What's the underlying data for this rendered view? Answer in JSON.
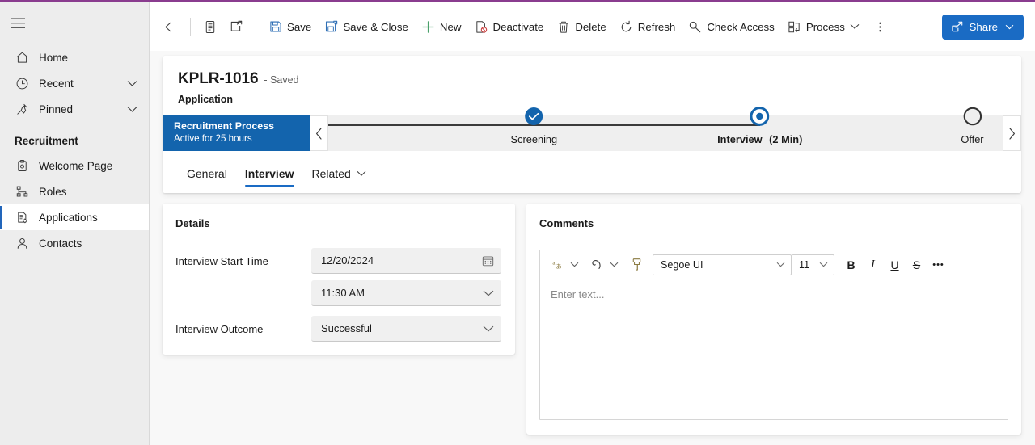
{
  "theme": {
    "accent_bar_color": "#8a3c8f",
    "primary_blue": "#1a6bc4",
    "bpf_header_blue": "#1364ad",
    "selection_bar_blue": "#2266bb"
  },
  "sidebar": {
    "hamburger_icon": "hamburger-menu-icon",
    "items": [
      {
        "label": "Home",
        "icon": "home-icon",
        "expandable": false,
        "selected": false
      },
      {
        "label": "Recent",
        "icon": "clock-icon",
        "expandable": true,
        "selected": false
      },
      {
        "label": "Pinned",
        "icon": "pin-icon",
        "expandable": true,
        "selected": false
      }
    ],
    "group_title": "Recruitment",
    "group_items": [
      {
        "label": "Welcome Page",
        "icon": "clipboard-icon",
        "selected": false
      },
      {
        "label": "Roles",
        "icon": "hierarchy-icon",
        "selected": false
      },
      {
        "label": "Applications",
        "icon": "document-edit-icon",
        "selected": true
      },
      {
        "label": "Contacts",
        "icon": "person-icon",
        "selected": false
      }
    ]
  },
  "commandbar": {
    "back_icon": "back-arrow-icon",
    "form_icon": "form-icon",
    "popout_icon": "popout-icon",
    "buttons": [
      {
        "label": "Save",
        "icon": "save-icon"
      },
      {
        "label": "Save & Close",
        "icon": "save-and-close-icon"
      },
      {
        "label": "New",
        "icon": "plus-icon"
      },
      {
        "label": "Deactivate",
        "icon": "deactivate-icon"
      },
      {
        "label": "Delete",
        "icon": "trash-icon"
      },
      {
        "label": "Refresh",
        "icon": "refresh-icon"
      },
      {
        "label": "Check Access",
        "icon": "key-icon"
      },
      {
        "label": "Process",
        "icon": "process-icon",
        "has_caret": true
      }
    ],
    "overflow_icon": "more-vertical-icon",
    "share": {
      "label": "Share",
      "icon": "share-icon",
      "caret_icon": "chevron-down-icon"
    }
  },
  "record": {
    "title": "KPLR-1016",
    "saved_state": "- Saved",
    "entity": "Application"
  },
  "bpf": {
    "name": "Recruitment Process",
    "active_for": "Active for 25 hours",
    "prev_icon": "chevron-left-icon",
    "next_icon": "chevron-right-icon",
    "stages": [
      {
        "label": "Screening",
        "duration": "",
        "state": "completed",
        "x_pct": 30.5
      },
      {
        "label": "Interview",
        "duration": "(2 Min)",
        "state": "current",
        "x_pct": 64.0
      },
      {
        "label": "Offer",
        "duration": "",
        "state": "future",
        "x_pct": 95.5
      }
    ]
  },
  "tabs": [
    {
      "label": "General",
      "active": false,
      "has_caret": false
    },
    {
      "label": "Interview",
      "active": true,
      "has_caret": false
    },
    {
      "label": "Related",
      "active": false,
      "has_caret": true
    }
  ],
  "details": {
    "title": "Details",
    "fields": [
      {
        "label": "Interview Start Time",
        "value": "12/20/2024",
        "icon": "calendar-icon",
        "name": "interview-start-date"
      },
      {
        "label": "",
        "value": "11:30 AM",
        "icon": "chevron-down-icon",
        "name": "interview-start-time"
      },
      {
        "label": "Interview Outcome",
        "value": "Successful",
        "icon": "chevron-down-icon",
        "name": "interview-outcome"
      }
    ]
  },
  "comments": {
    "title": "Comments",
    "toolbar": {
      "language_icon": "language-translate-icon",
      "language_caret": "chevron-down-icon",
      "undo_icon": "undo-icon",
      "undo_caret": "chevron-down-icon",
      "format_painter_icon": "format-painter-icon",
      "font_family": "Segoe UI",
      "font_size": "11",
      "bold_label": "B",
      "italic_label": "I",
      "underline_label": "U",
      "strikethrough_label": "S",
      "more_label": "•••"
    },
    "editor_placeholder": "Enter text..."
  }
}
